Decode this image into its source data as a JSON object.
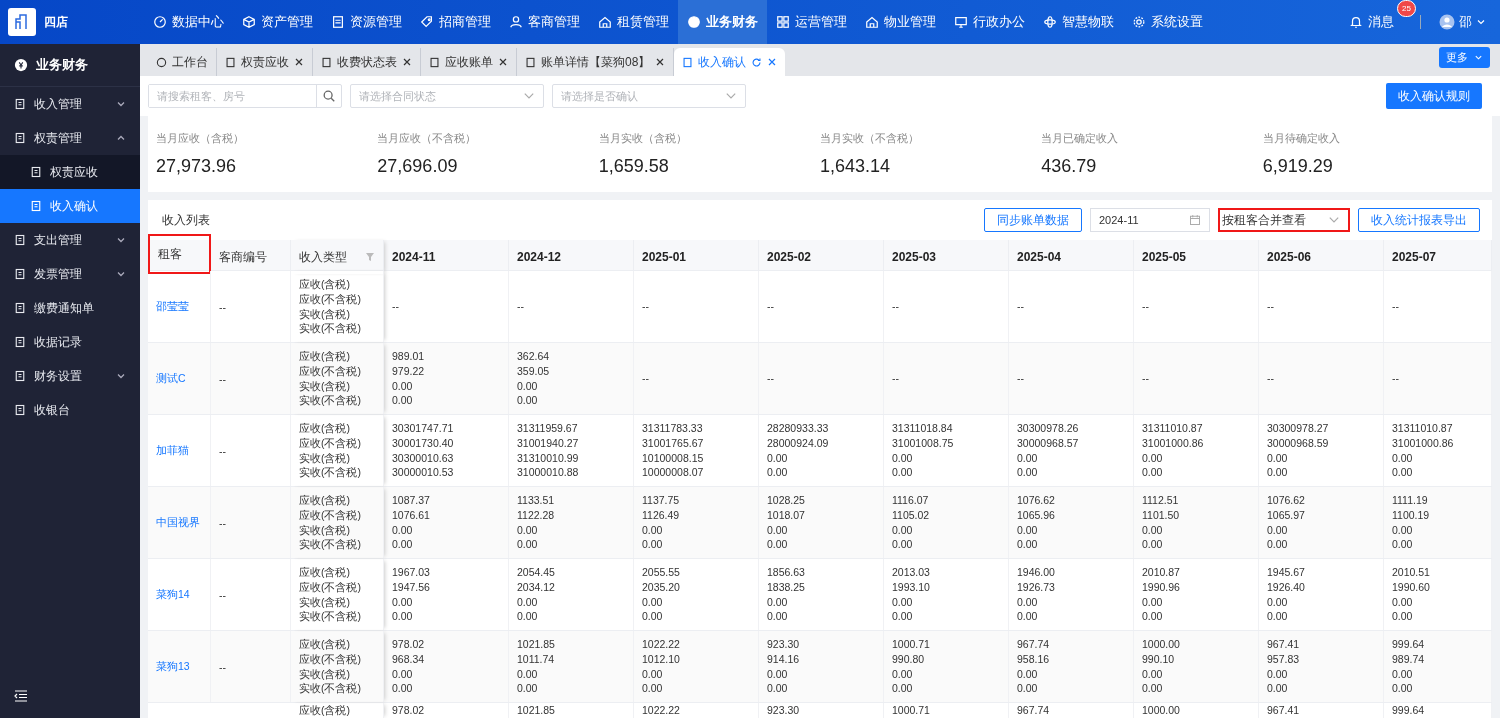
{
  "brand": {
    "name": "四店"
  },
  "top_nav": [
    {
      "label": "数据中心",
      "selected": false
    },
    {
      "label": "资产管理",
      "selected": false
    },
    {
      "label": "资源管理",
      "selected": false
    },
    {
      "label": "招商管理",
      "selected": false
    },
    {
      "label": "客商管理",
      "selected": false
    },
    {
      "label": "租赁管理",
      "selected": false
    },
    {
      "label": "业务财务",
      "selected": true
    },
    {
      "label": "运营管理",
      "selected": false
    },
    {
      "label": "物业管理",
      "selected": false
    },
    {
      "label": "行政办公",
      "selected": false
    },
    {
      "label": "智慧物联",
      "selected": false
    },
    {
      "label": "系统设置",
      "selected": false
    }
  ],
  "messages": {
    "label": "消息",
    "badge": "25"
  },
  "user": {
    "name": "邵"
  },
  "sidebar": {
    "title": "业务财务",
    "items": [
      {
        "label": "收入管理",
        "expanded": false,
        "selected": false
      },
      {
        "label": "权责管理",
        "expanded": true,
        "selected": false,
        "children": [
          {
            "label": "权责应收",
            "selected": false
          },
          {
            "label": "收入确认",
            "selected": true
          }
        ]
      },
      {
        "label": "支出管理",
        "expanded": false,
        "selected": false
      },
      {
        "label": "发票管理",
        "expanded": false,
        "selected": false
      },
      {
        "label": "缴费通知单",
        "selected": false
      },
      {
        "label": "收据记录",
        "selected": false
      },
      {
        "label": "财务设置",
        "expanded": false,
        "selected": false
      },
      {
        "label": "收银台",
        "selected": false
      }
    ]
  },
  "tabs": [
    {
      "label": "工作台",
      "selected": false,
      "closable": false
    },
    {
      "label": "权责应收",
      "selected": false,
      "closable": true
    },
    {
      "label": "收费状态表",
      "selected": false,
      "closable": true
    },
    {
      "label": "应收账单",
      "selected": false,
      "closable": true
    },
    {
      "label": "账单详情【菜狗08】",
      "selected": false,
      "closable": true
    },
    {
      "label": "收入确认",
      "selected": true,
      "closable": true
    }
  ],
  "more_button": "更多",
  "filters": {
    "search": {
      "placeholder": "请搜索租客、房号"
    },
    "selects": [
      {
        "placeholder": "请选择合同状态"
      },
      {
        "placeholder": "请选择是否确认"
      }
    ],
    "rules_button": "收入确认规则"
  },
  "stats": [
    {
      "label": "当月应收（含税）",
      "value": "27,973.96"
    },
    {
      "label": "当月应收（不含税）",
      "value": "27,696.09"
    },
    {
      "label": "当月实收（含税）",
      "value": "1,659.58"
    },
    {
      "label": "当月实收（不含税）",
      "value": "1,643.14"
    },
    {
      "label": "当月已确定收入",
      "value": "436.79"
    },
    {
      "label": "当月待确定收入",
      "value": "6,919.29"
    }
  ],
  "table_toolbar": {
    "title": "收入列表",
    "sync_button": "同步账单数据",
    "month": "2024-11",
    "view_select": {
      "value": "按租客合并查看",
      "highlighted": true
    },
    "export_button": "收入统计报表导出"
  },
  "table": {
    "columns": [
      {
        "label": "租客",
        "highlighted": true,
        "filter": false
      },
      {
        "label": "客商编号",
        "highlighted": false,
        "filter": false
      },
      {
        "label": "收入类型",
        "highlighted": false,
        "filter": true
      }
    ],
    "months": [
      "2024-11",
      "2024-12",
      "2025-01",
      "2025-02",
      "2025-03",
      "2025-04",
      "2025-05",
      "2025-06",
      "2025-07"
    ],
    "rows": [
      {
        "tenant": "邵莹莹",
        "code": "--",
        "types": [
          "应收(含税)",
          "应收(不含税)",
          "实收(含税)",
          "实收(不含税)"
        ],
        "cells": [
          [
            "--"
          ],
          [
            "--"
          ],
          [
            "--"
          ],
          [
            "--"
          ],
          [
            "--"
          ],
          [
            "--"
          ],
          [
            "--"
          ],
          [
            "--"
          ],
          [
            "--"
          ]
        ]
      },
      {
        "tenant": "测试C",
        "code": "--",
        "types": [
          "应收(含税)",
          "应收(不含税)",
          "实收(含税)",
          "实收(不含税)"
        ],
        "cells": [
          [
            "989.01",
            "979.22",
            "0.00",
            "0.00"
          ],
          [
            "362.64",
            "359.05",
            "0.00",
            "0.00"
          ],
          [
            "--"
          ],
          [
            "--"
          ],
          [
            "--"
          ],
          [
            "--"
          ],
          [
            "--"
          ],
          [
            "--"
          ],
          [
            "--"
          ]
        ]
      },
      {
        "tenant": "加菲猫",
        "code": "--",
        "types": [
          "应收(含税)",
          "应收(不含税)",
          "实收(含税)",
          "实收(不含税)"
        ],
        "cells": [
          [
            "30301747.71",
            "30001730.40",
            "30300010.63",
            "30000010.53"
          ],
          [
            "31311959.67",
            "31001940.27",
            "31310010.99",
            "31000010.88"
          ],
          [
            "31311783.33",
            "31001765.67",
            "10100008.15",
            "10000008.07"
          ],
          [
            "28280933.33",
            "28000924.09",
            "0.00",
            "0.00"
          ],
          [
            "31311018.84",
            "31001008.75",
            "0.00",
            "0.00"
          ],
          [
            "30300978.26",
            "30000968.57",
            "0.00",
            "0.00"
          ],
          [
            "31311010.87",
            "31001000.86",
            "0.00",
            "0.00"
          ],
          [
            "30300978.27",
            "30000968.59",
            "0.00",
            "0.00"
          ],
          [
            "31311010.87",
            "31001000.86",
            "0.00",
            "0.00"
          ]
        ]
      },
      {
        "tenant": "中国视界",
        "code": "--",
        "types": [
          "应收(含税)",
          "应收(不含税)",
          "实收(含税)",
          "实收(不含税)"
        ],
        "cells": [
          [
            "1087.37",
            "1076.61",
            "0.00",
            "0.00"
          ],
          [
            "1133.51",
            "1122.28",
            "0.00",
            "0.00"
          ],
          [
            "1137.75",
            "1126.49",
            "0.00",
            "0.00"
          ],
          [
            "1028.25",
            "1018.07",
            "0.00",
            "0.00"
          ],
          [
            "1116.07",
            "1105.02",
            "0.00",
            "0.00"
          ],
          [
            "1076.62",
            "1065.96",
            "0.00",
            "0.00"
          ],
          [
            "1112.51",
            "1101.50",
            "0.00",
            "0.00"
          ],
          [
            "1076.62",
            "1065.97",
            "0.00",
            "0.00"
          ],
          [
            "1111.19",
            "1100.19",
            "0.00",
            "0.00"
          ]
        ]
      },
      {
        "tenant": "菜狗14",
        "code": "--",
        "types": [
          "应收(含税)",
          "应收(不含税)",
          "实收(含税)",
          "实收(不含税)"
        ],
        "cells": [
          [
            "1967.03",
            "1947.56",
            "0.00",
            "0.00"
          ],
          [
            "2054.45",
            "2034.12",
            "0.00",
            "0.00"
          ],
          [
            "2055.55",
            "2035.20",
            "0.00",
            "0.00"
          ],
          [
            "1856.63",
            "1838.25",
            "0.00",
            "0.00"
          ],
          [
            "2013.03",
            "1993.10",
            "0.00",
            "0.00"
          ],
          [
            "1946.00",
            "1926.73",
            "0.00",
            "0.00"
          ],
          [
            "2010.87",
            "1990.96",
            "0.00",
            "0.00"
          ],
          [
            "1945.67",
            "1926.40",
            "0.00",
            "0.00"
          ],
          [
            "2010.51",
            "1990.60",
            "0.00",
            "0.00"
          ]
        ]
      },
      {
        "tenant": "菜狗13",
        "code": "--",
        "types": [
          "应收(含税)",
          "应收(不含税)",
          "实收(含税)",
          "实收(不含税)"
        ],
        "cells": [
          [
            "978.02",
            "968.34",
            "0.00",
            "0.00"
          ],
          [
            "1021.85",
            "1011.74",
            "0.00",
            "0.00"
          ],
          [
            "1022.22",
            "1012.10",
            "0.00",
            "0.00"
          ],
          [
            "923.30",
            "914.16",
            "0.00",
            "0.00"
          ],
          [
            "1000.71",
            "990.80",
            "0.00",
            "0.00"
          ],
          [
            "967.74",
            "958.16",
            "0.00",
            "0.00"
          ],
          [
            "1000.00",
            "990.10",
            "0.00",
            "0.00"
          ],
          [
            "967.41",
            "957.83",
            "0.00",
            "0.00"
          ],
          [
            "999.64",
            "989.74",
            "0.00",
            "0.00"
          ]
        ]
      },
      {
        "types": [
          "应收(含税)"
        ],
        "cells": [
          [
            "978.02"
          ],
          [
            "1021.85"
          ],
          [
            "1022.22"
          ],
          [
            "923.30"
          ],
          [
            "1000.71"
          ],
          [
            "967.74"
          ],
          [
            "1000.00"
          ],
          [
            "967.41"
          ],
          [
            "999.64"
          ]
        ]
      }
    ]
  }
}
